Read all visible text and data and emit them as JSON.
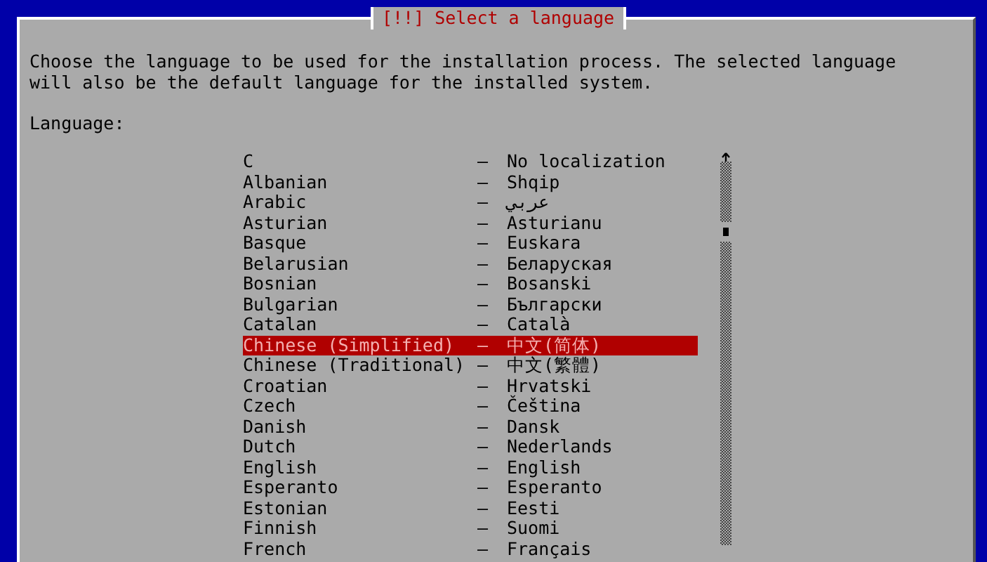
{
  "dialog": {
    "title": "[!!] Select a language",
    "description": "Choose the language to be used for the installation process. The selected language will also be the default language for the installed system.",
    "list_label": "Language:",
    "languages": [
      {
        "name": "C",
        "separator": "–",
        "native": "No localization",
        "selected": false
      },
      {
        "name": "Albanian",
        "separator": "–",
        "native": "Shqip",
        "selected": false
      },
      {
        "name": "Arabic",
        "separator": "–",
        "native": "عربي",
        "selected": false
      },
      {
        "name": "Asturian",
        "separator": "–",
        "native": "Asturianu",
        "selected": false
      },
      {
        "name": "Basque",
        "separator": "–",
        "native": "Euskara",
        "selected": false
      },
      {
        "name": "Belarusian",
        "separator": "–",
        "native": "Беларуская",
        "selected": false
      },
      {
        "name": "Bosnian",
        "separator": "–",
        "native": "Bosanski",
        "selected": false
      },
      {
        "name": "Bulgarian",
        "separator": "–",
        "native": "Български",
        "selected": false
      },
      {
        "name": "Catalan",
        "separator": "–",
        "native": "Català",
        "selected": false
      },
      {
        "name": "Chinese (Simplified)",
        "separator": "–",
        "native": "中文(简体)",
        "selected": true
      },
      {
        "name": "Chinese (Traditional)",
        "separator": "–",
        "native": "中文(繁體)",
        "selected": false
      },
      {
        "name": "Croatian",
        "separator": "–",
        "native": "Hrvatski",
        "selected": false
      },
      {
        "name": "Czech",
        "separator": "–",
        "native": "Čeština",
        "selected": false
      },
      {
        "name": "Danish",
        "separator": "–",
        "native": "Dansk",
        "selected": false
      },
      {
        "name": "Dutch",
        "separator": "–",
        "native": "Nederlands",
        "selected": false
      },
      {
        "name": "English",
        "separator": "–",
        "native": "English",
        "selected": false
      },
      {
        "name": "Esperanto",
        "separator": "–",
        "native": "Esperanto",
        "selected": false
      },
      {
        "name": "Estonian",
        "separator": "–",
        "native": "Eesti",
        "selected": false
      },
      {
        "name": "Finnish",
        "separator": "–",
        "native": "Suomi",
        "selected": false
      },
      {
        "name": "French",
        "separator": "–",
        "native": "Français",
        "selected": false
      }
    ]
  }
}
